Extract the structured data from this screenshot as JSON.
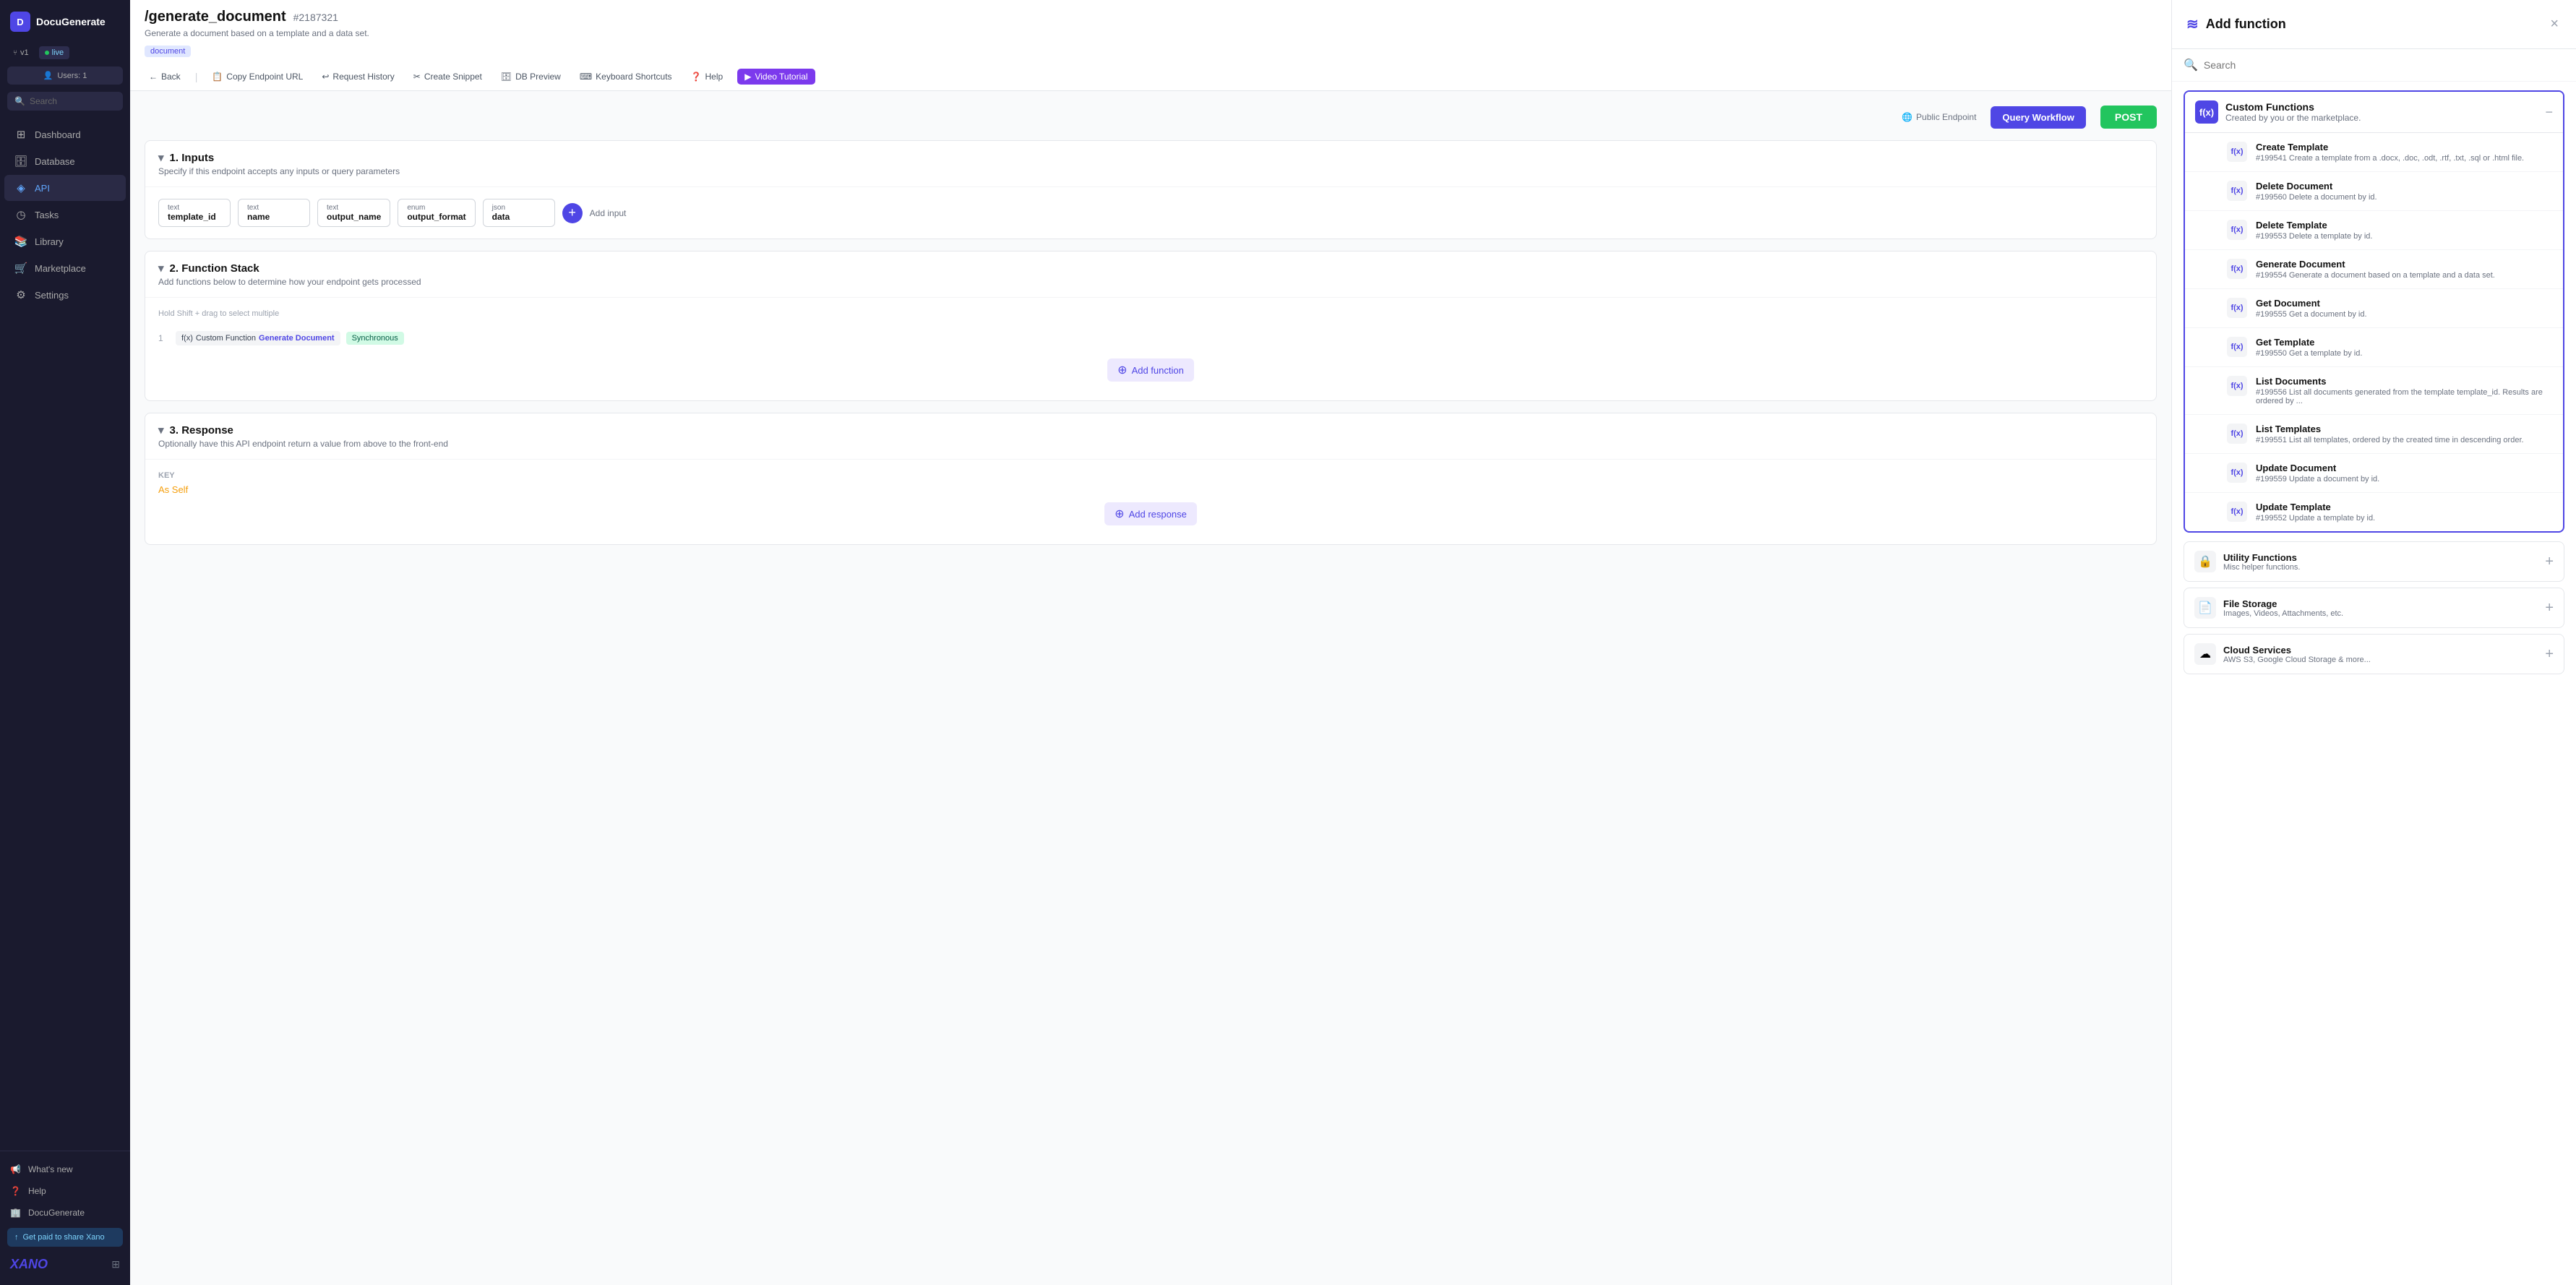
{
  "app": {
    "name": "DocuGenerate",
    "avatar": "D",
    "logo": "XANO"
  },
  "sidebar": {
    "tabs": [
      {
        "id": "v1",
        "label": "v1",
        "icon": "branch"
      },
      {
        "id": "live",
        "label": "live",
        "active": true,
        "dot": true
      }
    ],
    "users_label": "Users: 1",
    "search_placeholder": "Search",
    "nav_items": [
      {
        "id": "dashboard",
        "label": "Dashboard",
        "icon": "⊞"
      },
      {
        "id": "database",
        "label": "Database",
        "icon": "🗄"
      },
      {
        "id": "api",
        "label": "API",
        "icon": "◈",
        "active": true
      },
      {
        "id": "tasks",
        "label": "Tasks",
        "icon": "◷"
      },
      {
        "id": "library",
        "label": "Library",
        "icon": "📚"
      },
      {
        "id": "marketplace",
        "label": "Marketplace",
        "icon": "🛒"
      },
      {
        "id": "settings",
        "label": "Settings",
        "icon": "⚙"
      }
    ],
    "bottom_items": [
      {
        "id": "whats-new",
        "label": "What's new",
        "icon": "📢"
      },
      {
        "id": "help",
        "label": "Help",
        "icon": "?"
      },
      {
        "id": "docugenerate",
        "label": "DocuGenerate",
        "icon": "🏢"
      }
    ],
    "get_paid_label": "Get paid to share Xano",
    "expand_icon": "⊞"
  },
  "main": {
    "title": "/generate_document",
    "id": "#2187321",
    "subtitle": "Generate a document based on a template and a data set.",
    "badge": "document",
    "toolbar": [
      {
        "id": "back",
        "label": "Back",
        "icon": "←"
      },
      {
        "id": "copy-endpoint",
        "label": "Copy Endpoint URL",
        "icon": "📋"
      },
      {
        "id": "request-history",
        "label": "Request History",
        "icon": "↩"
      },
      {
        "id": "create-snippet",
        "label": "Create Snippet",
        "icon": "✂"
      },
      {
        "id": "db-preview",
        "label": "DB Preview",
        "icon": "🗄"
      },
      {
        "id": "keyboard-shortcuts",
        "label": "Keyboard Shortcuts",
        "icon": "⌨"
      },
      {
        "id": "help",
        "label": "Help",
        "icon": "?"
      },
      {
        "id": "video-tutorial",
        "label": "Video Tutorial",
        "icon": "▶"
      }
    ],
    "public_endpoint_label": "Public Endpoint",
    "query_workflow_label": "Query Workflow",
    "post_label": "POST",
    "sections": {
      "inputs": {
        "title": "1. Inputs",
        "subtitle": "Specify if this endpoint accepts any inputs or query parameters",
        "fields": [
          {
            "type": "text",
            "name": "template_id"
          },
          {
            "type": "text",
            "name": "name"
          },
          {
            "type": "text",
            "name": "output_name"
          },
          {
            "type": "enum",
            "name": "output_format"
          },
          {
            "type": "json",
            "name": "data"
          }
        ],
        "add_input_label": "Add input"
      },
      "function_stack": {
        "title": "2. Function Stack",
        "subtitle": "Add functions below to determine how your endpoint gets processed",
        "drag_hint": "Hold Shift + drag to select multiple",
        "functions": [
          {
            "number": "1",
            "prefix": "f(x)",
            "type": "Custom Function",
            "name": "Generate Document",
            "sync": "Synchronous"
          }
        ],
        "add_function_label": "Add function"
      },
      "response": {
        "title": "3. Response",
        "subtitle": "Optionally have this API endpoint return a value from above to the front-end",
        "key_label": "KEY",
        "value": "As Self",
        "add_response_label": "Add response"
      }
    }
  },
  "panel": {
    "title": "Add function",
    "title_icon": "≋",
    "search_placeholder": "Search",
    "close_icon": "×",
    "custom_functions_group": {
      "name": "Custom Functions",
      "desc": "Created by you or the marketplace.",
      "icon": "f(x)",
      "items": [
        {
          "id": "create-template",
          "name": "Create Template",
          "desc": "#199541 Create a template from a .docx, .doc, .odt, .rtf, .txt, .sql or .html file."
        },
        {
          "id": "delete-document",
          "name": "Delete Document",
          "desc": "#199560 Delete a document by id."
        },
        {
          "id": "delete-template",
          "name": "Delete Template",
          "desc": "#199553 Delete a template by id."
        },
        {
          "id": "generate-document",
          "name": "Generate Document",
          "desc": "#199554 Generate a document based on a template and a data set."
        },
        {
          "id": "get-document",
          "name": "Get Document",
          "desc": "#199555 Get a document by id."
        },
        {
          "id": "get-template",
          "name": "Get Template",
          "desc": "#199550 Get a template by id."
        },
        {
          "id": "list-documents",
          "name": "List Documents",
          "desc": "#199556 List all documents generated from the template template_id. Results are ordered by ..."
        },
        {
          "id": "list-templates",
          "name": "List Templates",
          "desc": "#199551 List all templates, ordered by the created time in descending order."
        },
        {
          "id": "update-document",
          "name": "Update Document",
          "desc": "#199559 Update a document by id."
        },
        {
          "id": "update-template",
          "name": "Update Template",
          "desc": "#199552 Update a template by id."
        }
      ]
    },
    "other_groups": [
      {
        "id": "utility-functions",
        "name": "Utility Functions",
        "desc": "Misc helper functions.",
        "icon": "🔒",
        "action": "+"
      },
      {
        "id": "file-storage",
        "name": "File Storage",
        "desc": "Images, Videos, Attachments, etc.",
        "icon": "📄",
        "action": "+"
      },
      {
        "id": "cloud-services",
        "name": "Cloud Services",
        "desc": "AWS S3, Google Cloud Storage & more...",
        "icon": "☁",
        "action": "+"
      }
    ]
  }
}
